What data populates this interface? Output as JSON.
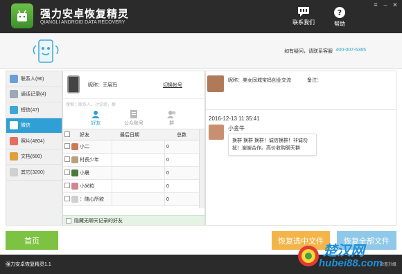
{
  "app": {
    "title": "强力安卓恢复精灵",
    "subtitle": "QIANGLI ANDROID DATA RECOVERY",
    "contact_label": "联系我们",
    "help_label": "帮助"
  },
  "banner": {
    "hint": "如有疑问，请联系客服",
    "phone": "400-007-6365"
  },
  "sidebar": {
    "items": [
      {
        "label": "联系人(96)",
        "color": "#6a9fd8",
        "active": false
      },
      {
        "label": "通话记录(4)",
        "color": "#9aa8b8",
        "active": false
      },
      {
        "label": "短信(47)",
        "color": "#3fa7d6",
        "active": false
      },
      {
        "label": "微信",
        "color": "#ffffff",
        "active": true
      },
      {
        "label": "照片(4804)",
        "color": "#e07060",
        "active": false
      },
      {
        "label": "文档(680)",
        "color": "#e0a040",
        "active": false
      },
      {
        "label": "其它(3200)",
        "color": "#d0d0d0",
        "active": false
      }
    ]
  },
  "account": {
    "name": "昵称：王层玛",
    "switch_label": "切换帐号",
    "search_placeholder": "搜索：联系人，讨论组，群"
  },
  "tabs": [
    {
      "label": "好友",
      "active": true
    },
    {
      "label": "公众账号",
      "active": false
    },
    {
      "label": "群",
      "active": false
    }
  ],
  "grid": {
    "headers": [
      "好友",
      "最后日期",
      "总数"
    ],
    "rows": [
      {
        "name": "小二",
        "date": "",
        "total": "0",
        "color": "#c97b5a"
      },
      {
        "name": "村長少年",
        "date": "",
        "total": "0",
        "color": "#b8a080"
      },
      {
        "name": "小晨",
        "date": "",
        "total": "0",
        "color": "#4a7a3a"
      },
      {
        "name": "小米粒",
        "date": "",
        "total": "0",
        "color": "#d08890"
      },
      {
        "name": "：随心所欲",
        "date": "",
        "total": "0",
        "color": "#d0d0d0"
      }
    ],
    "hide_empty_label": "隐藏无聊天记录的好友"
  },
  "chat": {
    "contact_nick": "昵称：美女同城宝妈创业交流",
    "contact_note": "备注：",
    "time": "2016-12-13 11:35:41",
    "sender": "小金牛",
    "message": "换群 换群 换群！诚信换群！非诚勿扰！谢谢合作。高价收购聊天群"
  },
  "buttons": {
    "home": "首页",
    "recover_selected": "恢复选中文件",
    "recover_all": "恢复全部文件"
  },
  "status": {
    "version": "强力安卓恢复精灵1.1",
    "check_update": "检查升级"
  },
  "watermark": {
    "line1": "楚汉网",
    "line2": "hubei88.com"
  }
}
